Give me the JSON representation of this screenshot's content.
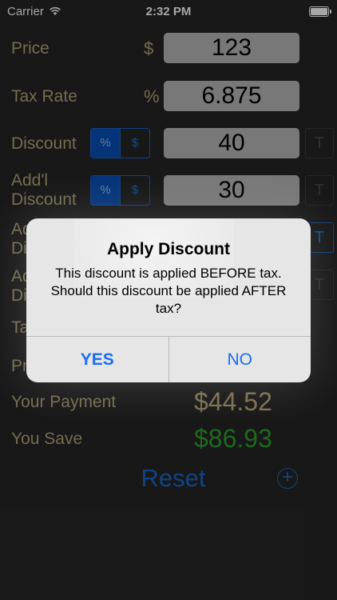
{
  "status": {
    "carrier": "Carrier",
    "time": "2:32 PM"
  },
  "form": {
    "price": {
      "label": "Price",
      "symbol": "$",
      "value": "123"
    },
    "tax_rate": {
      "label": "Tax Rate",
      "symbol": "%",
      "value": "6.875"
    },
    "discount": {
      "label": "Discount",
      "value": "40",
      "seg_percent": "%",
      "seg_dollar": "$",
      "t_label": "T"
    },
    "addl_discount": {
      "label_line1": "Add'l",
      "label_line2": "Discount",
      "value": "30",
      "seg_percent": "%",
      "seg_dollar": "$",
      "t_label": "T"
    },
    "row3": {
      "label_line1": "Ad",
      "label_line2": "Di",
      "t_label": "T"
    },
    "row4": {
      "label_line1": "Ad",
      "label_line2": "Di",
      "t_label": "T"
    },
    "row5": {
      "label": "Ta"
    },
    "row6": {
      "label": "Pr"
    }
  },
  "results": {
    "payment_label": "Your Payment",
    "payment_value": "$44.52",
    "save_label": "You Save",
    "save_value": "$86.93"
  },
  "actions": {
    "reset_label": "Reset",
    "add_label": "+"
  },
  "alert": {
    "title": "Apply Discount",
    "message": "This discount is applied BEFORE tax. Should this discount be applied AFTER tax?",
    "yes_label": "YES",
    "no_label": "NO"
  },
  "colors": {
    "label_gold": "#b2a77b",
    "payment_gold": "#bcae7c",
    "save_green": "#2fa12f",
    "accent_blue": "#1a6ac8"
  }
}
